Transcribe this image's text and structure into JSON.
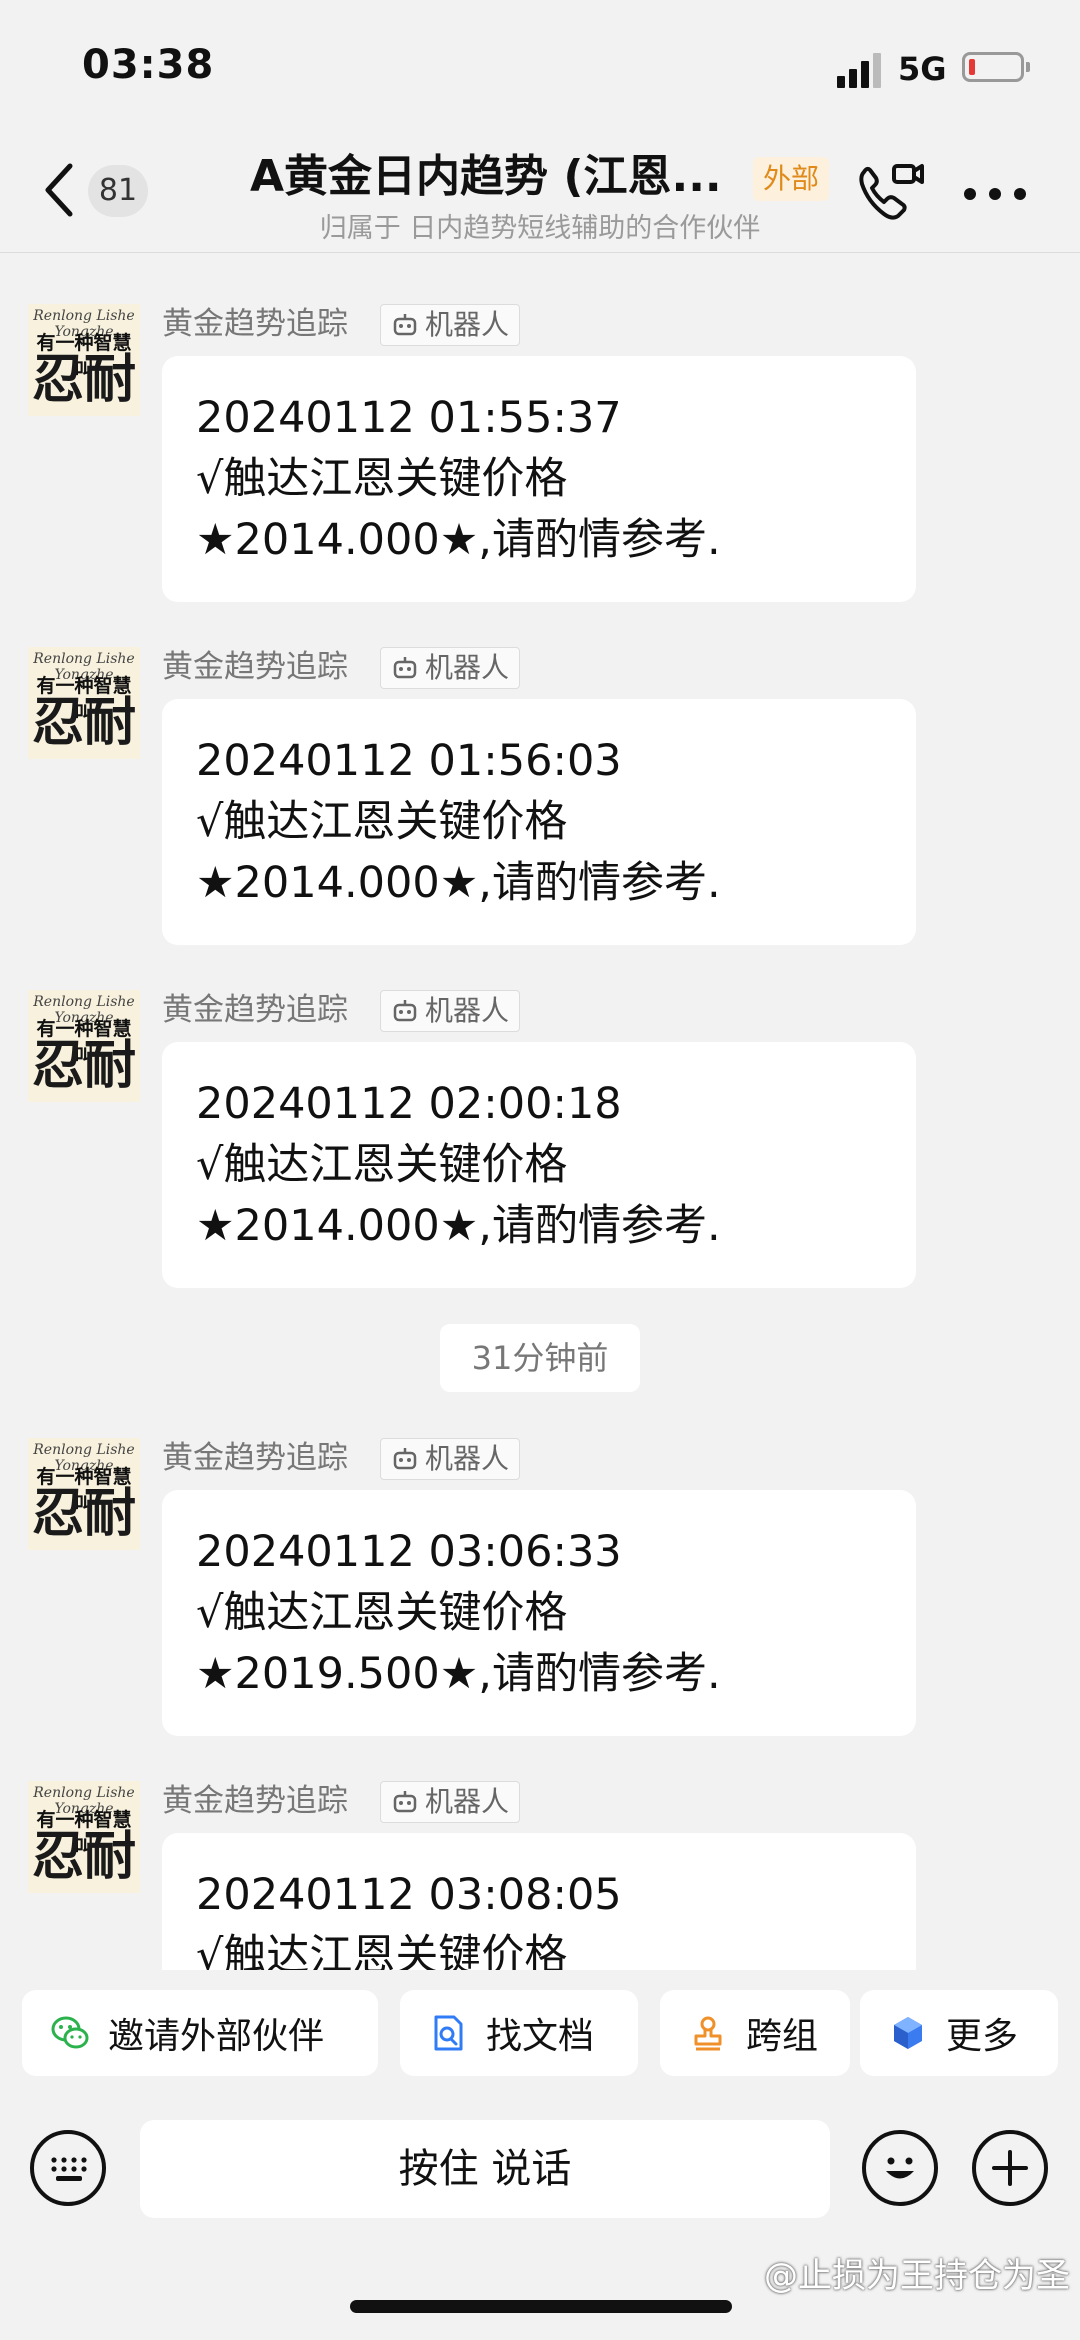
{
  "status_bar": {
    "time": "03:38",
    "network": "5G"
  },
  "header": {
    "unread_count": "81",
    "title": "A黄金日内趋势 (江恩...",
    "badge": "外部",
    "subtitle": "归属于 日内趋势短线辅助的合作伙伴"
  },
  "avatar": {
    "top": "Renlong Lishe Yongzhe",
    "mid": "有一种智慧叫",
    "big": "忍耐"
  },
  "messages": [
    {
      "sender": "黄金趋势追踪",
      "tag": "机器人",
      "line1": "20240112 01:55:37",
      "line2": "√触达江恩关键价格",
      "line3": "★2014.000★,请酌情参考."
    },
    {
      "sender": "黄金趋势追踪",
      "tag": "机器人",
      "line1": "20240112 01:56:03",
      "line2": "√触达江恩关键价格",
      "line3": "★2014.000★,请酌情参考."
    },
    {
      "sender": "黄金趋势追踪",
      "tag": "机器人",
      "line1": "20240112 02:00:18",
      "line2": "√触达江恩关键价格",
      "line3": "★2014.000★,请酌情参考."
    },
    {
      "sender": "黄金趋势追踪",
      "tag": "机器人",
      "line1": "20240112 03:06:33",
      "line2": "√触达江恩关键价格",
      "line3": "★2019.500★,请酌情参考."
    },
    {
      "sender": "黄金趋势追踪",
      "tag": "机器人",
      "line1": "20240112 03:08:05",
      "line2": "√触达江恩关键价格",
      "line3": ""
    }
  ],
  "time_divider": "31分钟前",
  "quick_actions": [
    "邀请外部伙伴",
    "找文档",
    "跨组",
    "更多"
  ],
  "input": {
    "talk_label": "按住 说话"
  },
  "watermark": "@止损为王持仓为圣",
  "colors": {
    "background": "#f2f2f2",
    "badge_orange": "#e08a1a",
    "battery_low": "#e53935"
  }
}
